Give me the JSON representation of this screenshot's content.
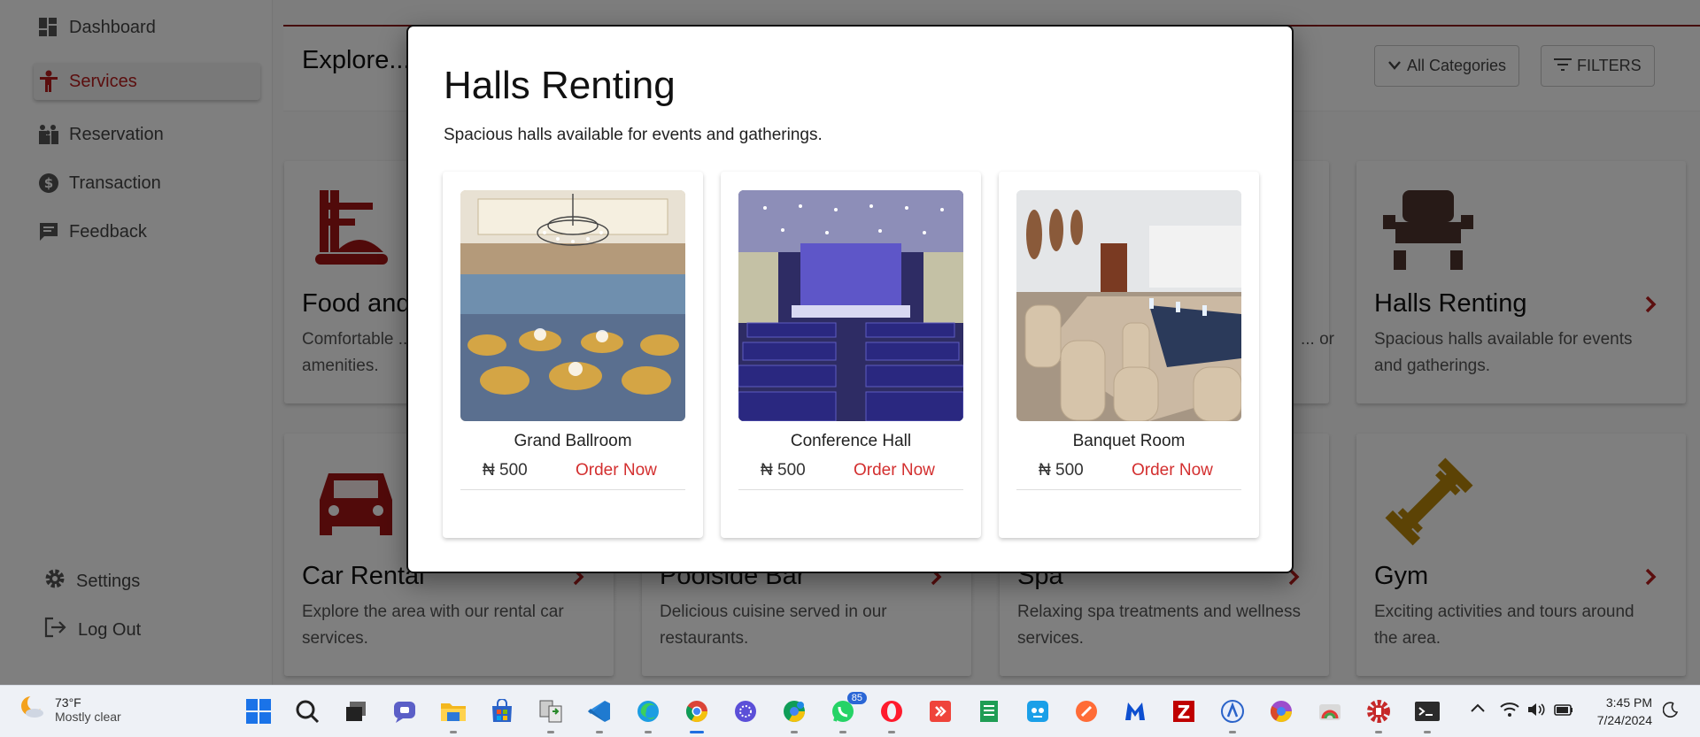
{
  "sidebar": {
    "items": [
      {
        "label": "Dashboard",
        "icon": "dashboard-icon"
      },
      {
        "label": "Services",
        "icon": "person-service-icon",
        "active": true
      },
      {
        "label": "Reservation",
        "icon": "people-icon"
      },
      {
        "label": "Transaction",
        "icon": "dollar-circle-icon"
      },
      {
        "label": "Feedback",
        "icon": "feedback-icon"
      }
    ],
    "settings_label": "Settings",
    "logout_label": "Log Out"
  },
  "header": {
    "title": "Explore...",
    "categories_label": "All Categories",
    "filters_label": "FILTERS"
  },
  "services": [
    {
      "title": "Food and Drinks",
      "desc": "Comfortable ... with modern amenities.",
      "icon": "food-icon",
      "color": "#a31515"
    },
    {
      "title": "",
      "desc": "",
      "icon": "",
      "color": ""
    },
    {
      "title": "",
      "desc": "... or",
      "icon": "",
      "color": ""
    },
    {
      "title": "Halls Renting",
      "desc": "Spacious halls available for events and gatherings.",
      "icon": "chair-icon",
      "color": "#4e342e"
    },
    {
      "title": "Car Rental",
      "desc": "Explore the area with our rental car services.",
      "icon": "car-icon",
      "color": "#a31515"
    },
    {
      "title": "Poolside Bar",
      "desc": "Delicious cuisine served in our restaurants.",
      "icon": "",
      "color": ""
    },
    {
      "title": "Spa",
      "desc": "Relaxing spa treatments and wellness services.",
      "icon": "",
      "color": ""
    },
    {
      "title": "Gym",
      "desc": "Exciting activities and tours around the area.",
      "icon": "dumbbell-icon",
      "color": "#b8860b"
    }
  ],
  "modal": {
    "title": "Halls Renting",
    "description": "Spacious halls available for events and gatherings.",
    "halls": [
      {
        "name": "Grand Ballroom",
        "price": "₦ 500",
        "action": "Order Now"
      },
      {
        "name": "Conference Hall",
        "price": "₦ 500",
        "action": "Order Now"
      },
      {
        "name": "Banquet Room",
        "price": "₦ 500",
        "action": "Order Now"
      }
    ]
  },
  "taskbar": {
    "weather_temp": "73°F",
    "weather_desc": "Mostly clear",
    "whatsapp_badge": "85",
    "time": "3:45 PM",
    "date": "7/24/2024"
  },
  "colors": {
    "accent": "#b71c1c",
    "order": "#d32f2f",
    "overlay": "rgba(0,0,0,0.5)"
  }
}
